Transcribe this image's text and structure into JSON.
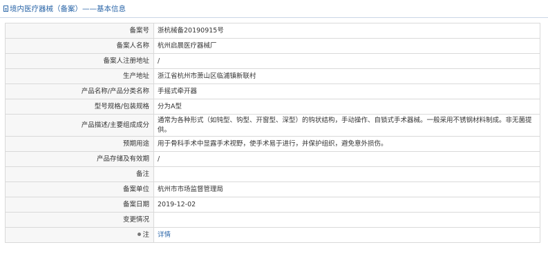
{
  "header": {
    "title": "境内医疗器械（备案）——基本信息",
    "icon": "document-icon"
  },
  "rows": [
    {
      "label": "备案号",
      "value": "浙杭械备20190915号"
    },
    {
      "label": "备案人名称",
      "value": "杭州启晨医疗器械厂"
    },
    {
      "label": "备案人注册地址",
      "value": "/"
    },
    {
      "label": "生产地址",
      "value": "浙江省杭州市萧山区临浦镇新联村"
    },
    {
      "label": "产品名称/产品分类名称",
      "value": "手摇式牵开器"
    },
    {
      "label": "型号规格/包装规格",
      "value": "分为A型"
    },
    {
      "label": "产品描述/主要组成成分",
      "value": "通常为各种形式（如钝型、钩型、开窗型、深型）的钩状结构，手动操作、自锁式手术器械。一般采用不锈钢材料制成。非无菌提供。"
    },
    {
      "label": "预期用途",
      "value": "用于骨科手术中显露手术视野，使手术易于进行，并保护组织，避免意外损伤。"
    },
    {
      "label": "产品存储及有效期",
      "value": "/"
    },
    {
      "label": "备注",
      "value": ""
    },
    {
      "label": "备案单位",
      "value": "杭州市市场监督管理局"
    },
    {
      "label": "备案日期",
      "value": "2019-12-02"
    },
    {
      "label": "变更情况",
      "value": ""
    },
    {
      "label": "注",
      "value": "详情"
    }
  ]
}
